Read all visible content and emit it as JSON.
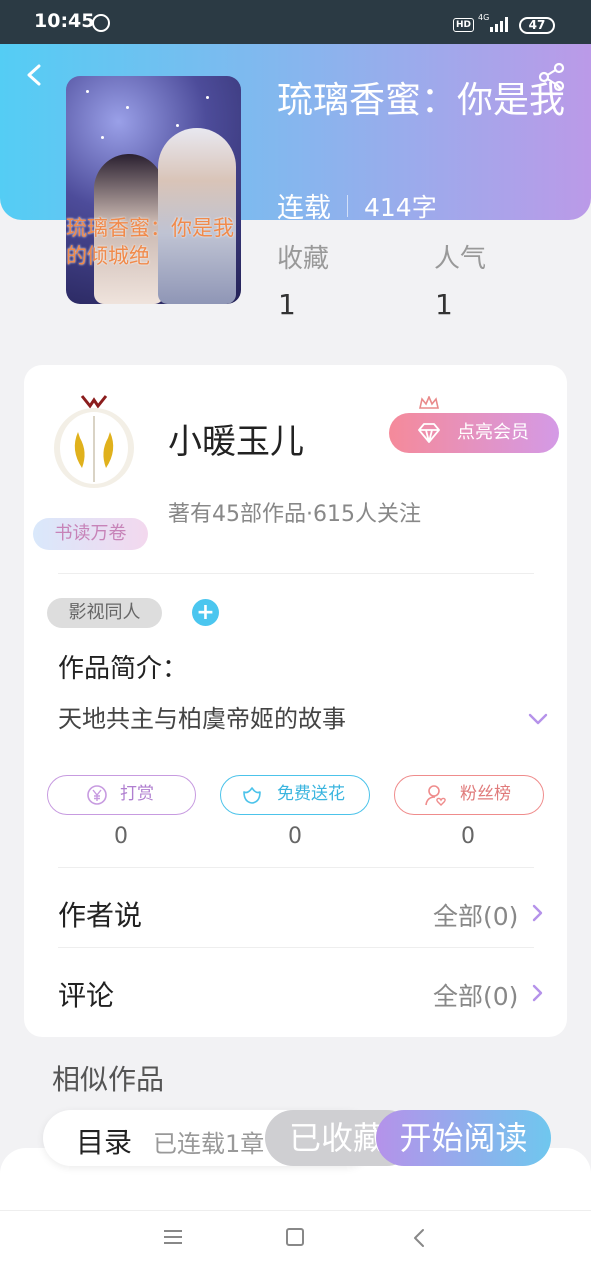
{
  "status_bar": {
    "time": "10:45",
    "hd": "HD",
    "network": "4G",
    "battery": "47"
  },
  "book": {
    "title": "琉璃香蜜：你是我的倾…",
    "cover_text": "琉璃香蜜：你是我的倾城绝",
    "status": "连载",
    "word_count": "414字"
  },
  "stats": {
    "favorites_label": "收藏",
    "favorites_value": "1",
    "popularity_label": "人气",
    "popularity_value": "1"
  },
  "author": {
    "name": "小暖玉儿",
    "badge": "书读万卷",
    "summary": "著有45部作品·615人关注",
    "vip_button": "点亮会员"
  },
  "work": {
    "genre_tag": "影视同人",
    "add_tag": "+",
    "intro_label": "作品简介：",
    "intro_text": "天地共主与柏虞帝姬的故事"
  },
  "actions": [
    {
      "label": "打赏",
      "count": "0",
      "color": "#c79be0"
    },
    {
      "label": "免费送花",
      "count": "0",
      "color": "#4cc3ea"
    },
    {
      "label": "粉丝榜",
      "count": "0",
      "color": "#ef8c8c"
    }
  ],
  "rows": {
    "author_says_label": "作者说",
    "author_says_value": "全部(0)",
    "comments_label": "评论",
    "comments_value": "全部(0)"
  },
  "similar": {
    "title": "相似作品"
  },
  "bottom": {
    "toc_label": "目录",
    "toc_progress": "已连载1章",
    "collected": "已收藏",
    "read": "开始阅读"
  },
  "colors": {
    "accent_purple": "#b592ea",
    "accent_blue": "#54cdf4"
  }
}
